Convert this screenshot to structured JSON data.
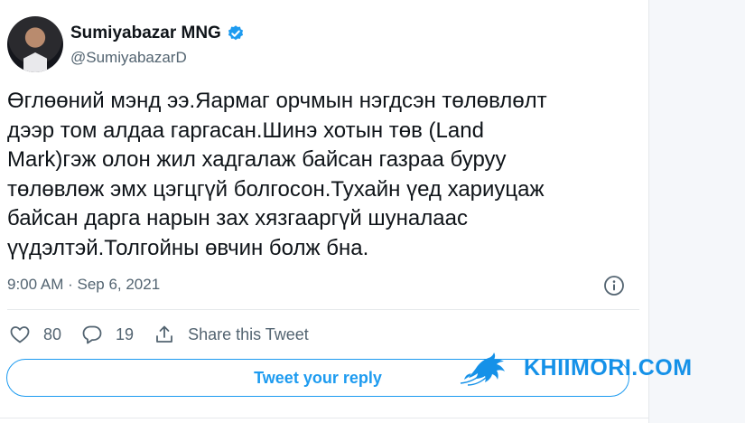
{
  "tweet": {
    "author_name": "Sumiyabazar MNG",
    "author_handle": "@SumiyabazarD",
    "text": "Өглөөний мэнд ээ.Яармаг орчмын нэгдсэн төлөвлөлт\nдээр том алдаа гаргасан.Шинэ хотын төв (Land\nMark)гэж олон жил хадгалаж байсан газраа буруу\nтөлөвлөж эмх цэгцгүй болгосон.Тухайн үед хариуцаж\nбайсан дарга нарын зах хязгааргүй шуналаас\nүүдэлтэй.Толгойны өвчин болж бна.",
    "timestamp": "9:00 AM · Sep 6, 2021",
    "likes": "80",
    "replies": "19",
    "share_label": "Share this Tweet",
    "reply_button": "Tweet your reply"
  },
  "icons": {
    "verified": "verified-badge-icon",
    "info": "info-icon",
    "like": "heart-icon",
    "reply": "speech-bubble-icon",
    "share": "share-upload-icon"
  },
  "watermark": {
    "text": "KHIIMORI.COM"
  },
  "colors": {
    "accent": "#1d9bf0",
    "secondary_text": "#536471",
    "watermark": "#1591e8"
  }
}
